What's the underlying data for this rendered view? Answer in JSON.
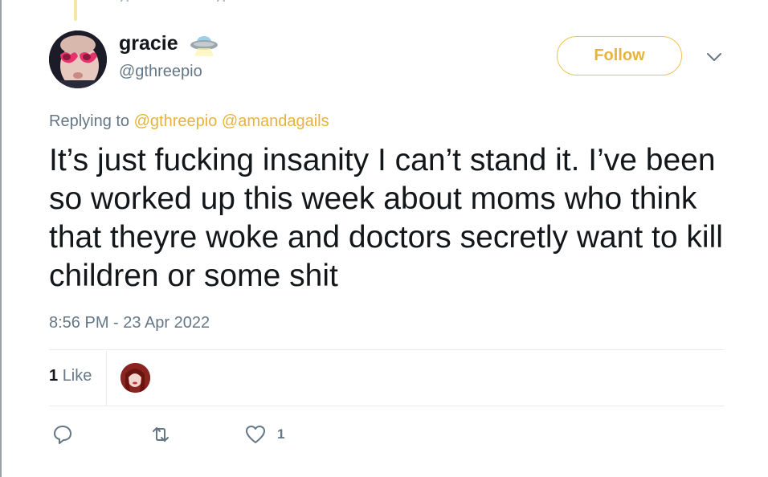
{
  "tweet": {
    "display_name": "gracie",
    "display_name_icon": "ufo-emoji-icon",
    "handle": "@gthreepio",
    "follow_label": "Follow",
    "menu_icon": "chevron-down-icon",
    "replying_prefix": "Replying to",
    "replying_mentions": [
      "@gthreepio",
      "@amandagails"
    ],
    "text": "It’s just fucking insanity I can’t stand it. I’ve been so worked up this week about moms who think that theyre woke and doctors secretly want to kill children or some shit",
    "timestamp": "8:56 PM - 23 Apr 2022",
    "likes_number": "1",
    "likes_word": "Like",
    "actions": {
      "reply_icon": "reply-icon",
      "retweet_icon": "retweet-icon",
      "like_icon": "heart-icon",
      "like_count": "1"
    }
  },
  "colors": {
    "accent": "#e6b43c",
    "muted_text": "#657786",
    "divider": "#e6ecf0"
  }
}
